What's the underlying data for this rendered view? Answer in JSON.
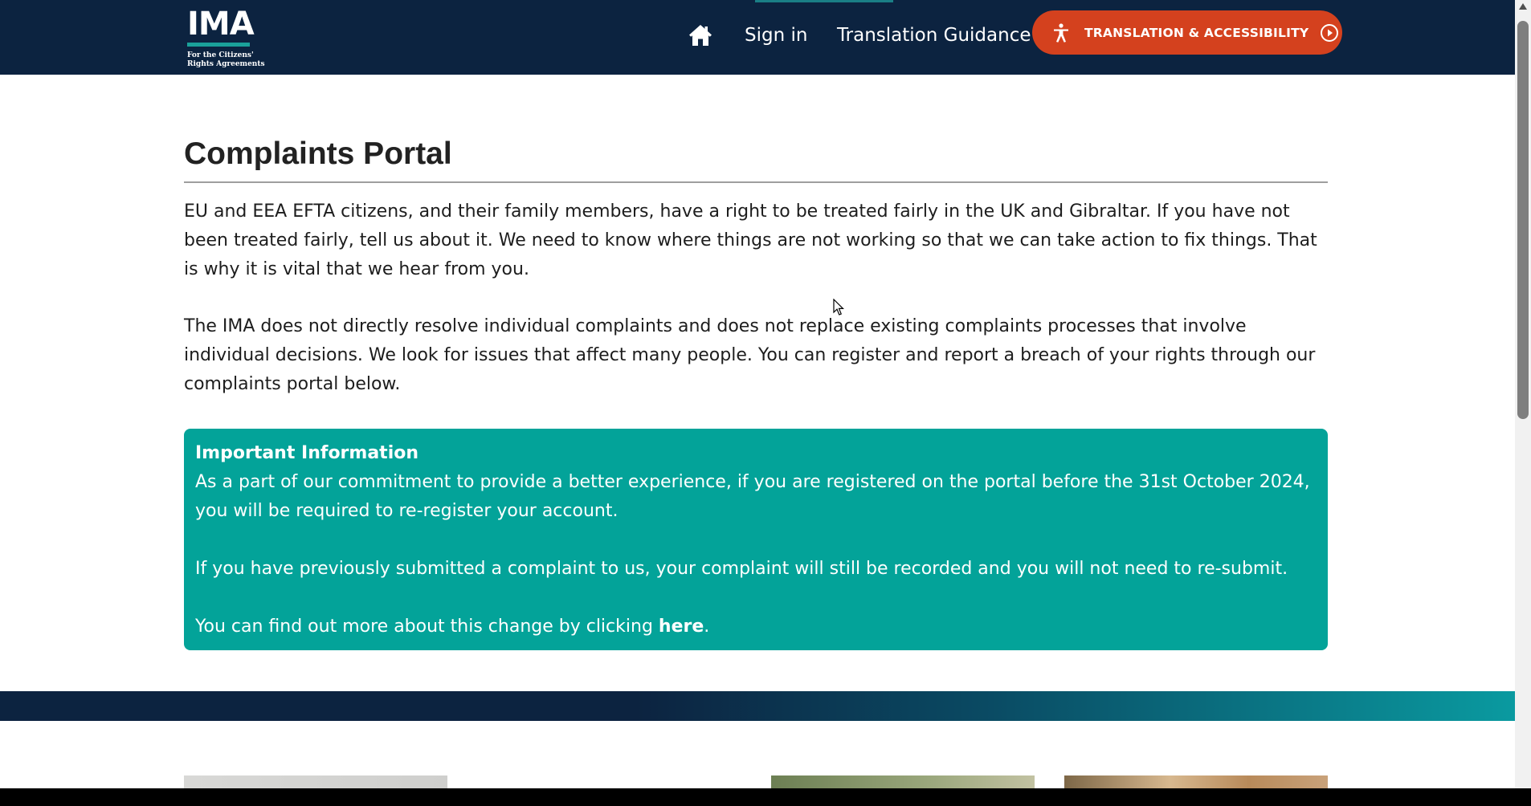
{
  "header": {
    "logo": {
      "mark": "IMA",
      "tagline_line1": "For the Citizens'",
      "tagline_line2": "Rights Agreements"
    },
    "nav": {
      "home_icon": "home-icon",
      "signin": "Sign in",
      "translation_guidance": "Translation Guidance"
    },
    "translation_button": {
      "label": "TRANSLATION & ACCESSIBILITY",
      "icon": "accessibility-person-icon",
      "arrow_icon": "circle-play-icon"
    }
  },
  "main": {
    "title": "Complaints Portal",
    "paragraph1": "EU and EEA EFTA citizens, and their family members, have a right to be treated fairly in the UK and Gibraltar. If you have not been treated fairly, tell us about it. We need to know where things are not working so that we can take action to fix things. That is why it is vital that we hear from you.",
    "paragraph2": "The IMA does not directly resolve individual complaints and does not replace existing complaints processes that involve individual decisions. We look for issues that affect many people. You can register and report a breach of your rights through our complaints portal below.",
    "info": {
      "heading": "Important Information",
      "para1": "As a part of our commitment to provide a better experience, if you are registered on the portal before the 31st October 2024, you will be required to re-register your account.",
      "para2": "If you have previously submitted a complaint to us, your complaint will still be recorded and you will not need to re-submit.",
      "para3_prefix": "You can find out more about this change by clicking ",
      "link": "here",
      "para3_suffix": "."
    }
  },
  "colors": {
    "header_bg": "#0c2340",
    "accent_orange": "#d4411e",
    "info_teal": "#03a399",
    "logo_teal": "#1aa19a"
  }
}
